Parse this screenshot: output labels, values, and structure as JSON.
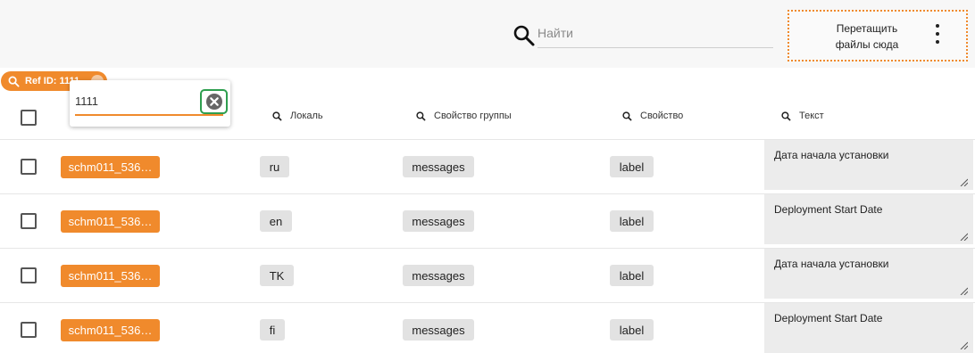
{
  "toolbar": {
    "search_placeholder": "Найти",
    "dropzone_line1": "Перетащить",
    "dropzone_line2": "файлы сюда",
    "menu_icon": "kebab-menu-icon"
  },
  "filter_chip": {
    "label": "Ref ID: 1111"
  },
  "filter_popup": {
    "value": "1111",
    "clear_icon": "clear-circle-icon"
  },
  "columns": {
    "locale": "Локаль",
    "group_property": "Свойство группы",
    "property": "Свойство",
    "text": "Текст"
  },
  "rows": [
    {
      "key": "schm011_536…",
      "locale": "ru",
      "group": "messages",
      "property": "label",
      "text": "Дата начала установки"
    },
    {
      "key": "schm011_536…",
      "locale": "en",
      "group": "messages",
      "property": "label",
      "text": "Deployment Start Date"
    },
    {
      "key": "schm011_536…",
      "locale": "TK",
      "group": "messages",
      "property": "label",
      "text": "Дата начала установки"
    },
    {
      "key": "schm011_536…",
      "locale": "fi",
      "group": "messages",
      "property": "label",
      "text": "Deployment Start Date"
    }
  ],
  "colors": {
    "accent": "#f08a2c",
    "focus_ring": "#2e9e4f",
    "tag_bg": "#e2e2e2",
    "text_area_bg": "#ececec"
  }
}
